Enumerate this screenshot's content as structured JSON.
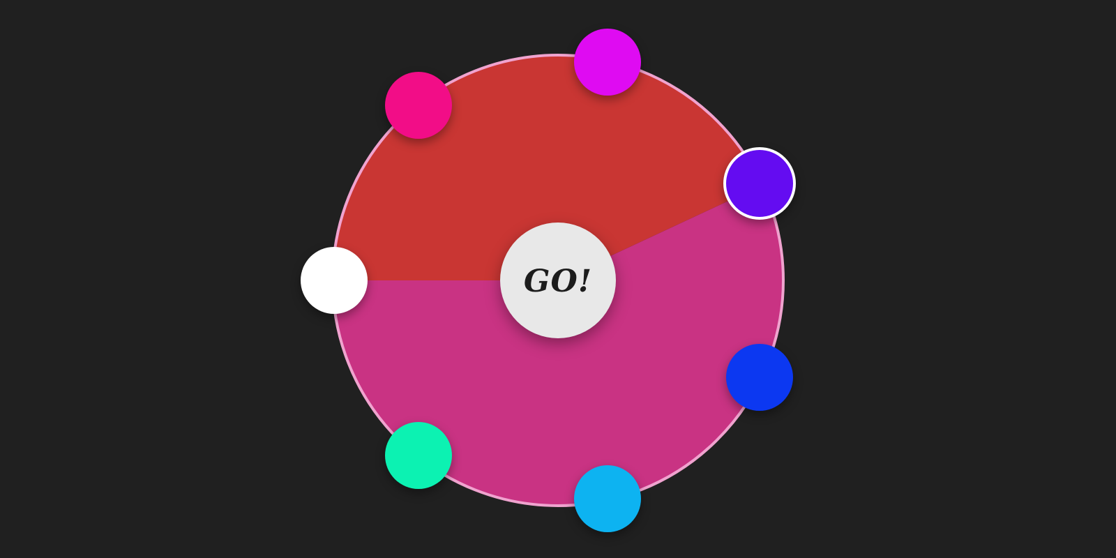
{
  "background_color": "#202020",
  "wheel": {
    "rim_color": "#f0a3cf",
    "segments": [
      {
        "name": "top",
        "color": "#c93633"
      },
      {
        "name": "bottom",
        "color": "#c93383"
      }
    ]
  },
  "go_button": {
    "label": "GO!",
    "color": "#e8e8e8"
  },
  "color_options": [
    {
      "name": "white",
      "color": "#ffffff",
      "selected": false
    },
    {
      "name": "hot-pink",
      "color": "#f20d87",
      "selected": false
    },
    {
      "name": "magenta",
      "color": "#df0bf2",
      "selected": false
    },
    {
      "name": "violet",
      "color": "#640cf1",
      "selected": true
    },
    {
      "name": "blue",
      "color": "#0c38f1",
      "selected": false
    },
    {
      "name": "sky-blue",
      "color": "#0db3f1",
      "selected": false
    },
    {
      "name": "mint",
      "color": "#0cf2b2",
      "selected": false
    }
  ]
}
